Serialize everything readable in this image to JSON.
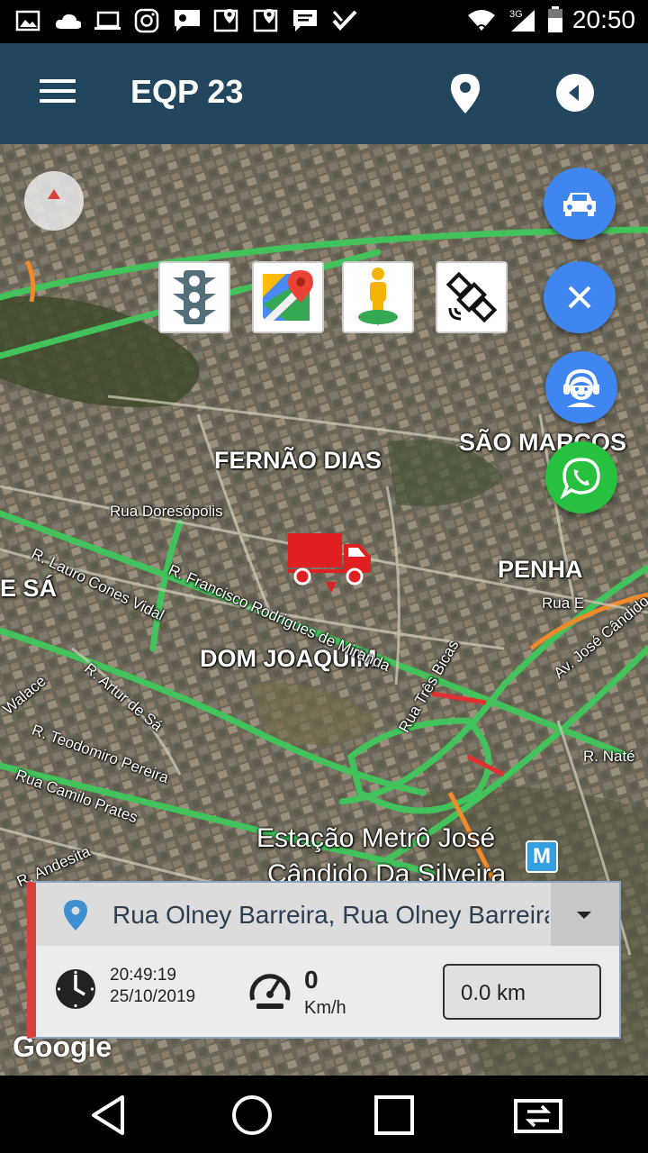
{
  "status_bar": {
    "time": "20:50",
    "network": "3G",
    "left_icons": [
      "image-icon",
      "cloud-icon",
      "laptop-icon",
      "instagram-icon",
      "chat-lg-icon",
      "maps-icon",
      "maps-icon",
      "message-icon",
      "check-icon"
    ]
  },
  "app_bar": {
    "title": "EQP 23"
  },
  "map": {
    "labels": {
      "fernao_dias": "FERNÃO DIAS",
      "sao_marcos": "SÃO MARCOS",
      "penha": "PENHA",
      "e_sa": "E SÁ",
      "dom_joaquim": "DOM JOAQUIM",
      "rua_doresopolis": "Rua Doresópolis",
      "rua_e": "Rua E",
      "r_nate": "R. Naté",
      "station_line1": "Estação Metrô José",
      "station_line2": "Cândido Da Silveira",
      "r_francisco": "R. Francisco Rodrigues de Miranda",
      "r_lauro": "R. Lauro Cones Vidal",
      "r_arthur": "R. Artur de Sá",
      "r_teodomiro": "R. Teodomiro Pereira",
      "rua_camilo": "Rua Camilo Prates",
      "r_andesita": "R. Andesita",
      "rua_tres_bicas": "Rua Três Bicas",
      "walace": "Walace",
      "av_jose_candido": "Av. José Cândido",
      "google": "Google",
      "metro_badge": "M"
    },
    "tiles": [
      "traffic-light-icon",
      "google-maps-icon",
      "street-view-icon",
      "satellite-icon"
    ]
  },
  "info_card": {
    "address": "Rua Olney Barreira, Rua Olney Barreira...",
    "time": "20:49:19",
    "date": "25/10/2019",
    "speed": "0",
    "speed_unit": "Km/h",
    "distance": "0.0 km"
  },
  "colors": {
    "app_bar": "#23465f",
    "fab_blue": "#3f86f0",
    "fab_green": "#27c13f",
    "card_accent": "#d9403b",
    "truck": "#e02020"
  }
}
